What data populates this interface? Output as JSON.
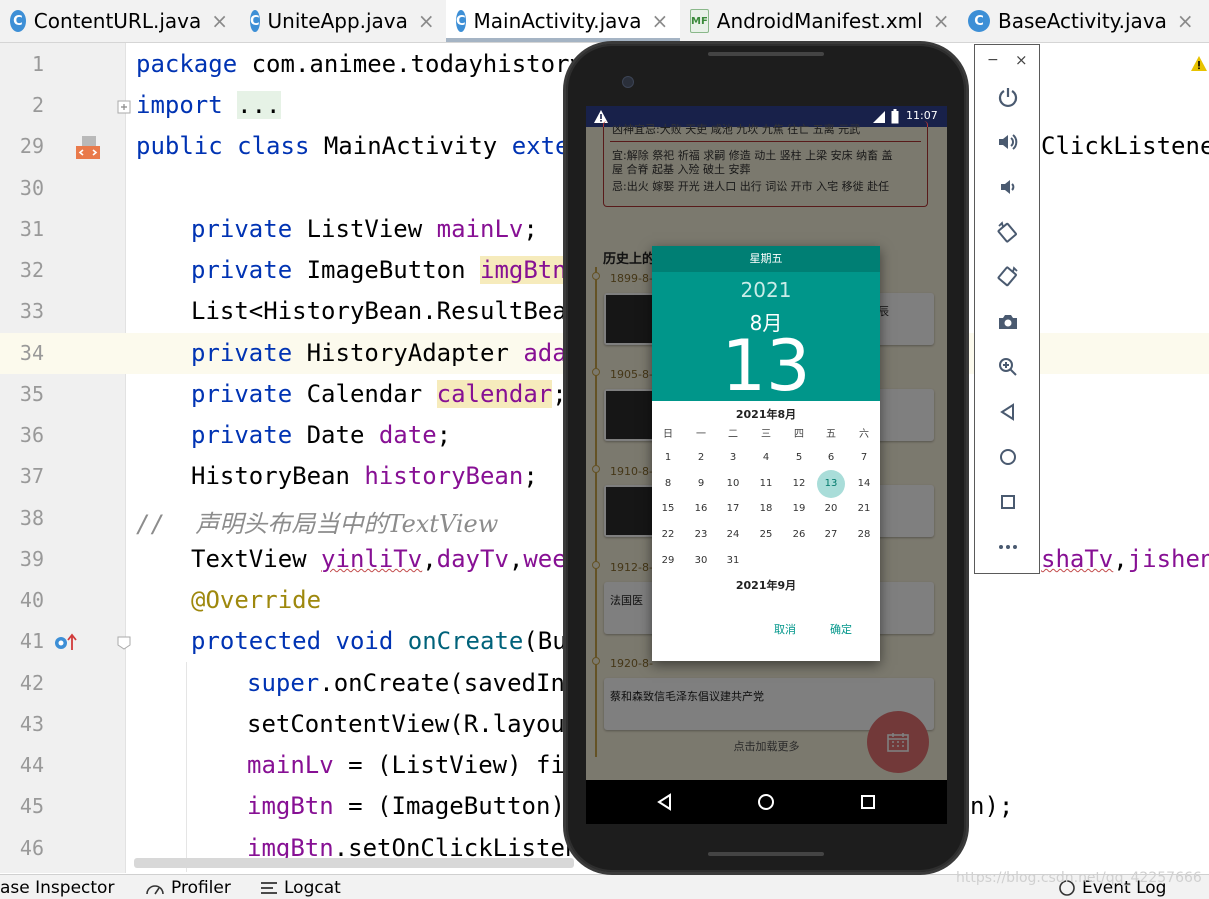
{
  "tabs": [
    {
      "label": "ContentURL.java",
      "icon": "C",
      "active": false
    },
    {
      "label": "UniteApp.java",
      "icon": "C",
      "active": false
    },
    {
      "label": "MainActivity.java",
      "icon": "C",
      "active": true
    },
    {
      "label": "AndroidManifest.xml",
      "icon": "MF",
      "active": false
    },
    {
      "label": "BaseActivity.java",
      "icon": "C",
      "active": false
    }
  ],
  "line_numbers": [
    "1",
    "2",
    "29",
    "30",
    "31",
    "32",
    "33",
    "34",
    "35",
    "36",
    "37",
    "38",
    "39",
    "40",
    "41",
    "42",
    "43",
    "44",
    "45",
    "46"
  ],
  "code": {
    "l1_kw": "package",
    "l1_rest": " com.animee.todayhistory",
    "l2_kw": "import",
    "l2_fold": "...",
    "l29_a": "public",
    "l29_b": "class",
    "l29_c": " MainActivity ",
    "l29_d": "exter",
    "l29_right": "ClickListene",
    "l31_kw": "private",
    "l31_type": " ListView ",
    "l31_fld": "mainLv",
    "l31_end": ";",
    "l32_kw": "private",
    "l32_type": " ImageButton ",
    "l32_fld": "imgBtn",
    "l32_end": ";",
    "l33_text": "List<HistoryBean.ResultBean",
    "l34_kw": "private",
    "l34_type": " HistoryAdapter ",
    "l34_fld": "adap",
    "l35_kw": "private",
    "l35_type": " Calendar ",
    "l35_fld": "calendar",
    "l35_end": ";",
    "l36_kw": "private",
    "l36_type": " Date ",
    "l36_fld": "date",
    "l36_end": ";",
    "l37_type": "HistoryBean ",
    "l37_fld": "historyBean",
    "l37_end": ";",
    "l38_slash": "//",
    "l38_comment": "    声明头布局当中的TextView",
    "l39_type": "TextView ",
    "l39_f1": "yinliTv",
    "l39_c1": ",",
    "l39_f2": "dayTv",
    "l39_c2": ",",
    "l39_f3": "week",
    "l39_right_f1": "shaTv",
    "l39_right_c": ",",
    "l39_right_f2": "jishen",
    "l40_ann": "@Override",
    "l41_kw1": "protected",
    "l41_kw2": " void ",
    "l41_fn": "onCreate",
    "l41_rest": "(Bun",
    "l42_kw": "super",
    "l42_rest": ".onCreate(savedIns",
    "l43_text": "setContentView(R.layout",
    "l44_fld": "mainLv",
    "l44_rest": " = (ListView) fir",
    "l45_fld": "imgBtn",
    "l45_rest": " = (ImageButton) ",
    "l45_right": "n);",
    "l46_fld": "imgBtn",
    "l46_rest": ".setOnClickListen"
  },
  "status_bar": {
    "layout_inspector": "ase Inspector",
    "profiler": "Profiler",
    "logcat": "Logcat",
    "event_log": "Event Log",
    "watermark": "https://blog.csdn.net/qq_42257666"
  },
  "phone": {
    "time": "11:07",
    "info_line1": "凶神宜忌:大败 天吏 咸池 九坎 九焦 往亡 五离 元武",
    "info_line2": "宜:解除 祭祀 祈福 求嗣 修造 动土 竖柱 上梁 安床 纳畜 盖",
    "info_line3": "屋 合脊 起基 入殓 破土 安葬",
    "info_line4": "忌:出火 嫁娶 开光 进人口 出行 词讼 开市 入宅 移徙 赴任",
    "history_title": "历史上的这一天",
    "events": [
      {
        "date": "1899-8-",
        "title": "辰",
        "photo": true
      },
      {
        "date": "1905-8-",
        "title": "",
        "photo": true
      },
      {
        "date": "1910-8-",
        "title": "",
        "photo": true
      },
      {
        "date": "1912-8-",
        "title": "法国医",
        "photo": false
      },
      {
        "date": "1920-8-",
        "title": "蔡和森致信毛泽东倡议建共产党",
        "photo": false
      }
    ],
    "load_more": "点击加载更多",
    "dialog": {
      "weekday": "星期五",
      "year": "2021",
      "month": "8月",
      "day": "13",
      "cal_title": "2021年8月",
      "next_month": "2021年9月",
      "weekdays": [
        "日",
        "一",
        "二",
        "三",
        "四",
        "五",
        "六"
      ],
      "weeks": [
        [
          "1",
          "2",
          "3",
          "4",
          "5",
          "6",
          "7"
        ],
        [
          "8",
          "9",
          "10",
          "11",
          "12",
          "13",
          "14"
        ],
        [
          "15",
          "16",
          "17",
          "18",
          "19",
          "20",
          "21"
        ],
        [
          "22",
          "23",
          "24",
          "25",
          "26",
          "27",
          "28"
        ],
        [
          "29",
          "30",
          "31",
          "",
          "",
          "",
          ""
        ]
      ],
      "selected_day": "13",
      "cancel": "取消",
      "ok": "确定"
    }
  },
  "emulator_toolbar": {
    "minimize": "−",
    "close": "×",
    "buttons": [
      "power-icon",
      "volume-up-icon",
      "volume-down-icon",
      "rotate-left-icon",
      "rotate-right-icon",
      "camera-icon",
      "zoom-icon",
      "back-icon",
      "home-icon",
      "overview-icon",
      "more-icon"
    ]
  },
  "colors": {
    "accent_teal": "#00968a",
    "keyword": "#0033b3",
    "field": "#871094",
    "annotation": "#9e880d"
  }
}
